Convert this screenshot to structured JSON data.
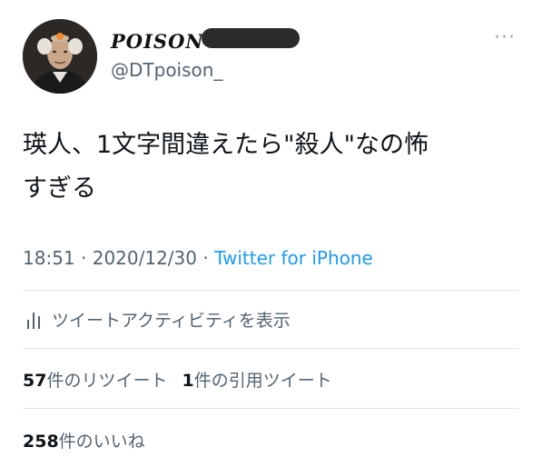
{
  "tweet": {
    "display_name": "POISON",
    "handle": "@DTpoison_",
    "more_label": "···",
    "text_line1": "瑛人、1文字間違えたら\"殺人\"なの怖",
    "text_line2": "すぎる",
    "time": "18:51",
    "separator": " · ",
    "date": "2020/12/30",
    "source": "Twitter for iPhone"
  },
  "activity": {
    "icon": "bar-chart-icon",
    "label": "ツイートアクティビティを表示"
  },
  "stats": {
    "retweets_count": "57",
    "retweets_label": "件のリツイート",
    "quotes_count": "1",
    "quotes_label": "件の引用ツイート",
    "likes_count": "258",
    "likes_label": "件のいいね"
  },
  "colors": {
    "link": "#1d9bf0",
    "secondary_text": "#536471",
    "primary_text": "#0f1419",
    "divider": "#e3e6e9"
  }
}
